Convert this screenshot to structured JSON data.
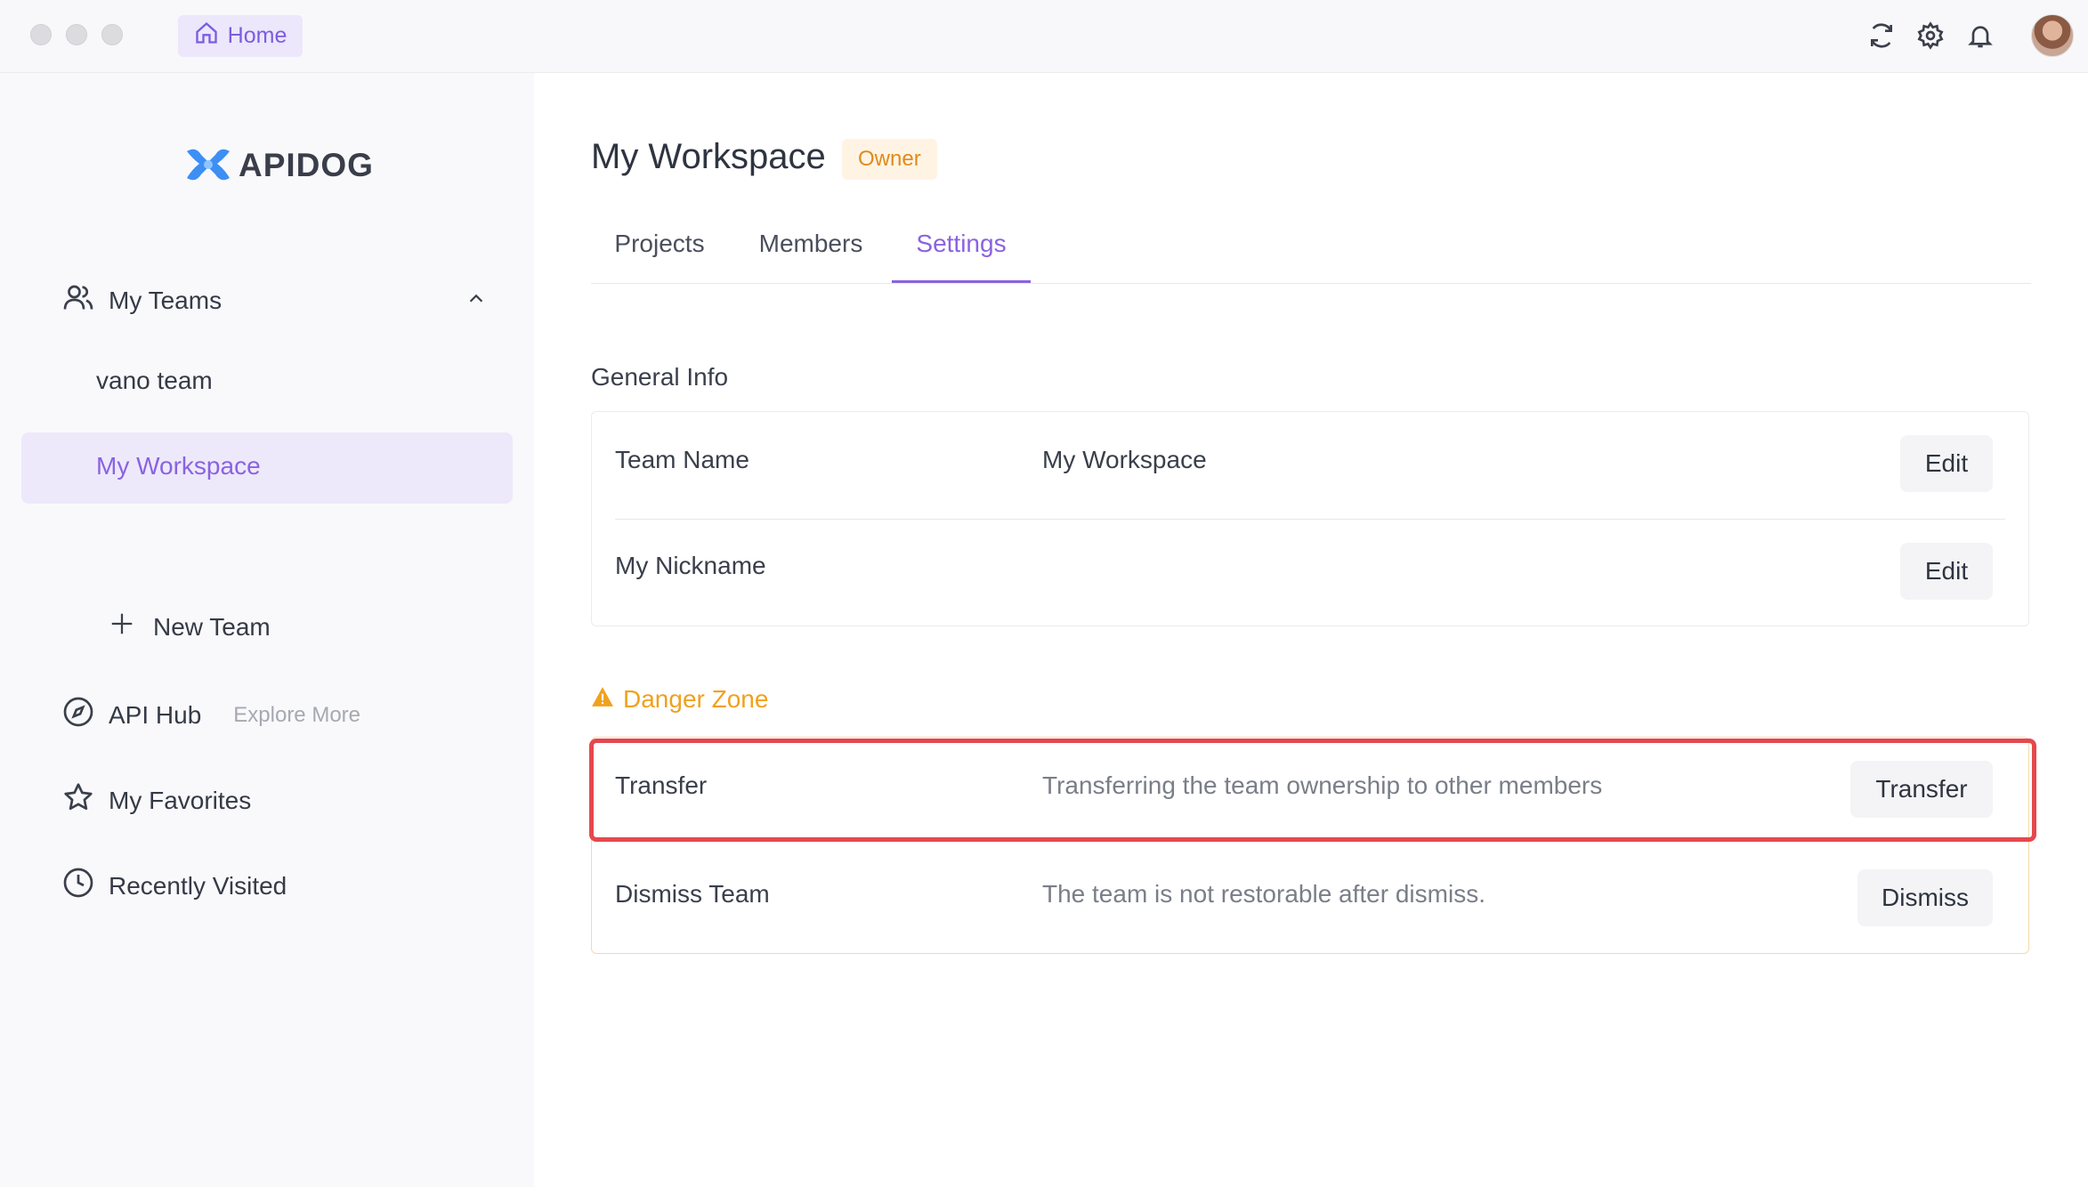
{
  "titlebar": {
    "home_label": "Home"
  },
  "sidebar": {
    "logo_text": "APIDOG",
    "my_teams_label": "My Teams",
    "teams": [
      "vano team",
      "My Workspace"
    ],
    "new_team_label": "New Team",
    "api_hub_label": "API Hub",
    "api_hub_hint": "Explore More",
    "favorites_label": "My Favorites",
    "recent_label": "Recently Visited"
  },
  "main": {
    "workspace_title": "My Workspace",
    "role_badge": "Owner",
    "tabs": [
      "Projects",
      "Members",
      "Settings"
    ],
    "active_tab": "Settings",
    "general_info": {
      "title": "General Info",
      "rows": [
        {
          "label": "Team Name",
          "value": "My Workspace",
          "action": "Edit"
        },
        {
          "label": "My Nickname",
          "value": "",
          "action": "Edit"
        }
      ]
    },
    "danger_zone": {
      "title": "Danger Zone",
      "rows": [
        {
          "label": "Transfer",
          "desc": "Transferring the team ownership to other members",
          "action": "Transfer"
        },
        {
          "label": "Dismiss Team",
          "desc": "The team is not restorable after dismiss.",
          "action": "Dismiss"
        }
      ]
    }
  },
  "colors": {
    "accent": "#8a63e0",
    "warning": "#f0a11e",
    "highlight": "#e5484d",
    "badge_text": "#e08a1c"
  }
}
